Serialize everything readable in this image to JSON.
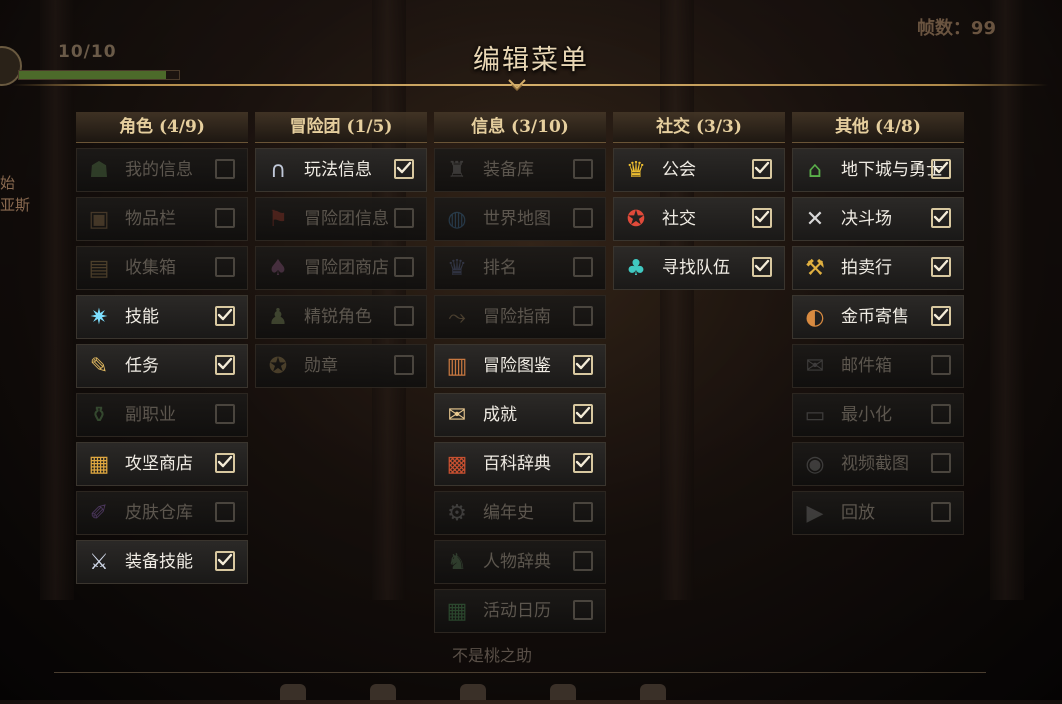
{
  "hud": {
    "level": "10/10",
    "fps": "帧数：99",
    "side_text": "始 亚斯",
    "bottom_text": "不是桃之助"
  },
  "title": "编辑菜单",
  "columns": [
    {
      "header": "角色 (4/9)",
      "items": [
        {
          "label": "我的信息",
          "checked": false,
          "icon": "person-icon"
        },
        {
          "label": "物品栏",
          "checked": false,
          "icon": "bag-icon"
        },
        {
          "label": "收集箱",
          "checked": false,
          "icon": "collection-box-icon"
        },
        {
          "label": "技能",
          "checked": true,
          "icon": "sparkle-icon"
        },
        {
          "label": "任务",
          "checked": true,
          "icon": "scroll-icon"
        },
        {
          "label": "副职业",
          "checked": false,
          "icon": "potion-icon"
        },
        {
          "label": "攻坚商店",
          "checked": true,
          "icon": "chest-icon"
        },
        {
          "label": "皮肤仓库",
          "checked": false,
          "icon": "brush-icon"
        },
        {
          "label": "装备技能",
          "checked": true,
          "icon": "sword-icon"
        }
      ]
    },
    {
      "header": "冒险团 (1/5)",
      "items": [
        {
          "label": "玩法信息",
          "checked": true,
          "icon": "arch-icon"
        },
        {
          "label": "冒险团信息",
          "checked": false,
          "icon": "banner-icon"
        },
        {
          "label": "冒险团商店",
          "checked": false,
          "icon": "shop-icon"
        },
        {
          "label": "精锐角色",
          "checked": false,
          "icon": "elite-icon"
        },
        {
          "label": "勋章",
          "checked": false,
          "icon": "medal-icon"
        }
      ]
    },
    {
      "header": "信息 (3/10)",
      "items": [
        {
          "label": "装备库",
          "checked": false,
          "icon": "armor-icon"
        },
        {
          "label": "世界地图",
          "checked": false,
          "icon": "globe-icon"
        },
        {
          "label": "排名",
          "checked": false,
          "icon": "ranking-icon"
        },
        {
          "label": "冒险指南",
          "checked": false,
          "icon": "route-icon"
        },
        {
          "label": "冒险图鉴",
          "checked": true,
          "icon": "book-icon"
        },
        {
          "label": "成就",
          "checked": true,
          "icon": "parchment-icon"
        },
        {
          "label": "百科辞典",
          "checked": true,
          "icon": "encyclopedia-icon"
        },
        {
          "label": "编年史",
          "checked": false,
          "icon": "gear-icon"
        },
        {
          "label": "人物辞典",
          "checked": false,
          "icon": "character-icon"
        },
        {
          "label": "活动日历",
          "checked": false,
          "icon": "calendar-icon"
        }
      ]
    },
    {
      "header": "社交 (3/3)",
      "items": [
        {
          "label": "公会",
          "checked": true,
          "icon": "guild-crest-icon"
        },
        {
          "label": "社交",
          "checked": true,
          "icon": "social-badge-icon"
        },
        {
          "label": "寻找队伍",
          "checked": true,
          "icon": "team-icon"
        }
      ]
    },
    {
      "header": "其他 (4/8)",
      "items": [
        {
          "label": "地下城与勇士",
          "checked": true,
          "icon": "house-icon"
        },
        {
          "label": "决斗场",
          "checked": true,
          "icon": "crossed-swords-icon"
        },
        {
          "label": "拍卖行",
          "checked": true,
          "icon": "gavel-icon"
        },
        {
          "label": "金币寄售",
          "checked": true,
          "icon": "coin-bag-icon"
        },
        {
          "label": "邮件箱",
          "checked": false,
          "icon": "mail-icon"
        },
        {
          "label": "最小化",
          "checked": false,
          "icon": "minimize-icon"
        },
        {
          "label": "视频截图",
          "checked": false,
          "icon": "camera-icon"
        },
        {
          "label": "回放",
          "checked": false,
          "icon": "replay-icon"
        }
      ]
    }
  ],
  "colors": {
    "accent_gold": "#d4ae6a",
    "header_text": "#e6cf9e",
    "enabled_text": "#f0ece4",
    "disabled_text": "#5c564e"
  }
}
